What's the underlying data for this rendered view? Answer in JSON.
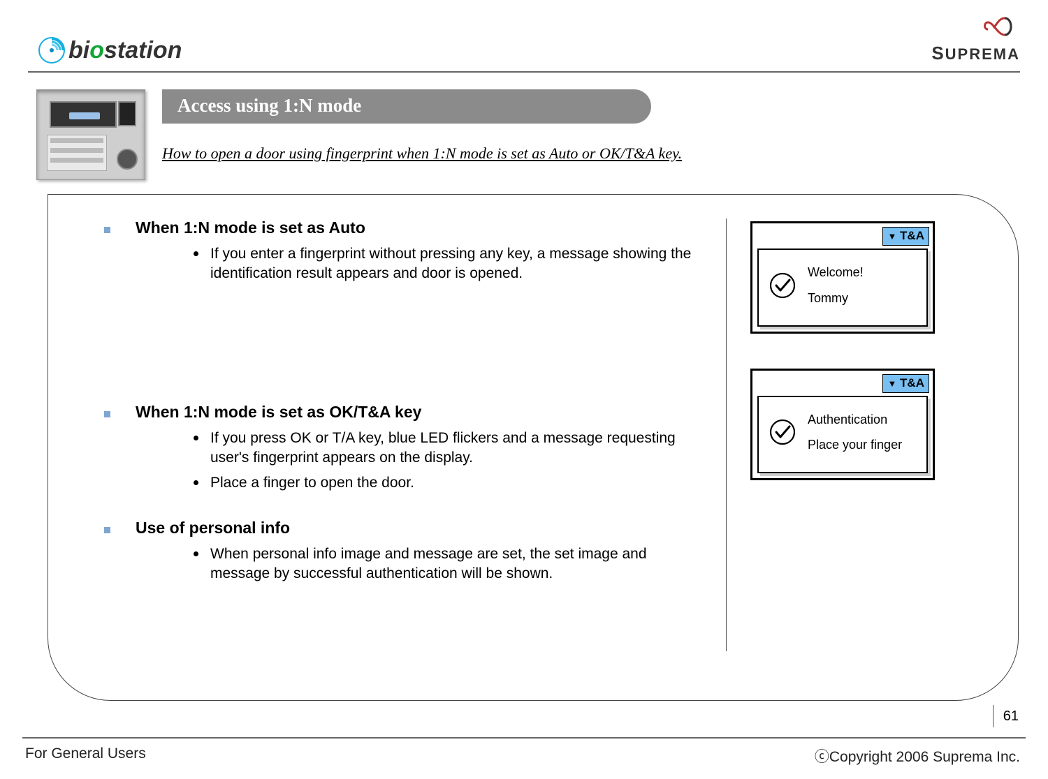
{
  "brand_left": {
    "bi": "bi",
    "o": "o",
    "rest": "station"
  },
  "brand_right": "SUPREMA",
  "title": "Access using 1:N mode",
  "subtitle": "How to open a door using fingerprint when 1:N mode is set as Auto or OK/T&A key.",
  "sections": [
    {
      "heading": "When 1:N mode is set as Auto",
      "items": [
        "If you enter a fingerprint without pressing any key, a message showing the identification result appears and door is opened."
      ]
    },
    {
      "heading": "When 1:N mode is set as OK/T&A key",
      "items": [
        "If you press OK or T/A key, blue LED flickers and a message requesting user's fingerprint appears on the display.",
        "Place a finger to open the door."
      ]
    },
    {
      "heading": "Use of personal info",
      "items": [
        "When personal info image and message are set, the set image and message by successful authentication will be shown."
      ]
    }
  ],
  "screens": [
    {
      "badge": "T&A",
      "line1": "Welcome!",
      "line2": "Tommy"
    },
    {
      "badge": "T&A",
      "line1": "Authentication",
      "line2": "Place your finger"
    }
  ],
  "page_number": "61",
  "footer_left": "For General Users",
  "footer_right": "ⓒCopyright 2006 Suprema Inc."
}
